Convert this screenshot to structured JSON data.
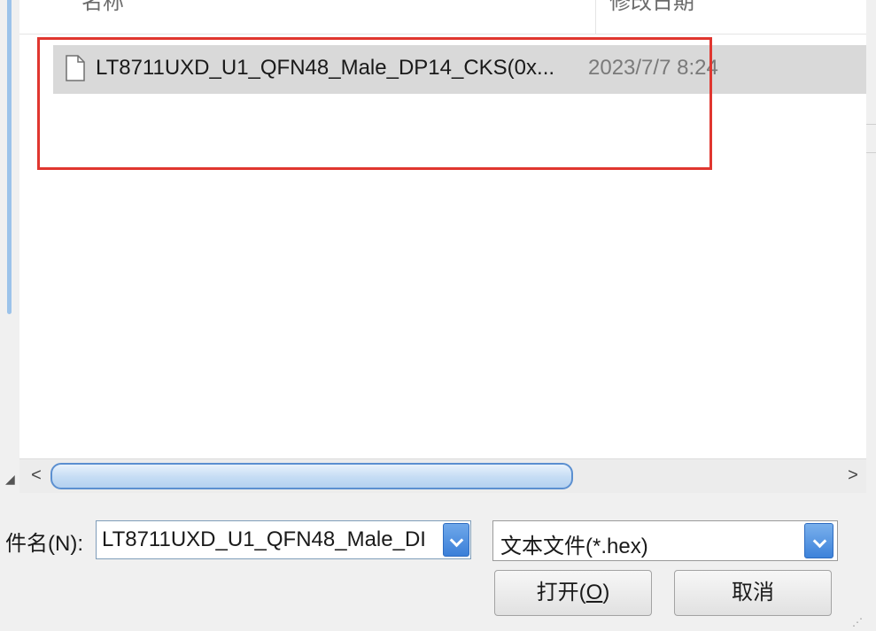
{
  "columns": {
    "name": "名称",
    "date_modified": "修改日期"
  },
  "files": [
    {
      "name": "LT8711UXD_U1_QFN48_Male_DP14_CKS(0x...",
      "date": "2023/7/7 8:24",
      "icon": "file-icon"
    }
  ],
  "hscroll": {
    "left_arrow": "<",
    "right_arrow": ">"
  },
  "filename": {
    "label": "件名(N):",
    "value": "LT8711UXD_U1_QFN48_Male_DI"
  },
  "filetype": {
    "value": "文本文件(*.hex)"
  },
  "buttons": {
    "open_text": "打开(",
    "open_mnemonic": "O",
    "open_close": ")",
    "cancel": "取消"
  },
  "colors": {
    "annotation": "#e0362f",
    "selection": "#d9d9d9",
    "accent": "#3b7fd8"
  }
}
